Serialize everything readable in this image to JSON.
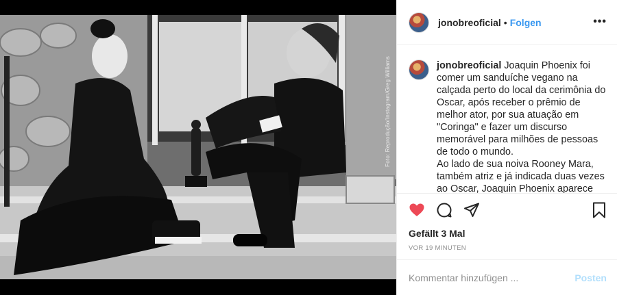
{
  "post": {
    "photo_credit": "Foto: Reprodução/Instagram/Greg Williams",
    "header": {
      "username": "jonobreoficial",
      "separator": "•",
      "follow_label": "Folgen",
      "more_label": "•••"
    },
    "caption": {
      "username": "jonobreoficial",
      "paragraph1": "Joaquin Phoenix foi comer um sanduíche vegano na calçada perto do local da cerimônia do Oscar, após receber o prêmio de melhor ator, por sua atuação em \"Coringa\" e fazer um discurso memorável para milhões de pessoas de todo o mundo.",
      "paragraph2": "Ao lado de sua noiva Rooney Mara, também atriz e já indicada duas vezes ao Oscar, Joaquin Phoenix aparece"
    },
    "actions": {
      "like_icon": "heart-icon",
      "comment_icon": "comment-icon",
      "share_icon": "paper-plane-icon",
      "save_icon": "bookmark-icon",
      "like_color": "#ed4956"
    },
    "likes_text": "Gefällt 3 Mal",
    "timestamp": "VOR 19 MINUTEN",
    "comment": {
      "placeholder": "Kommentar hinzufügen ...",
      "value": "",
      "post_label": "Posten"
    }
  }
}
